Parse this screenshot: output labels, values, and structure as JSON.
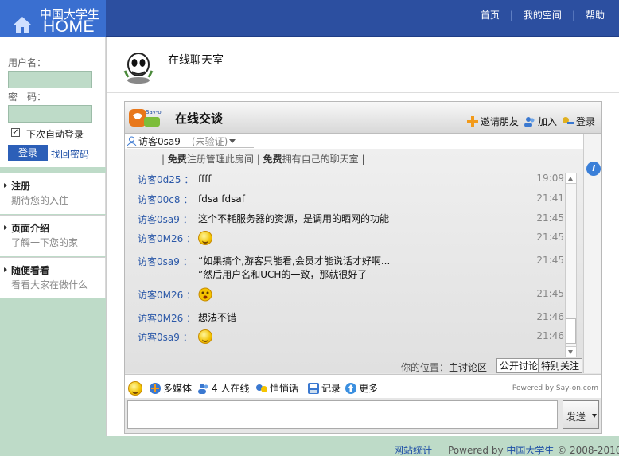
{
  "logo": {
    "cn": "中国大学生",
    "en": "HOME"
  },
  "topnav": [
    "首页",
    "我的空间",
    "帮助"
  ],
  "sidebar": {
    "username_label": "用户名：",
    "password_label": "密　码：",
    "remember_label": "下次自动登录",
    "login_label": "登录",
    "forgot_label": "找回密码",
    "sections": [
      {
        "title": "注册",
        "desc": "期待您的入住"
      },
      {
        "title": "页面介绍",
        "desc": "了解一下您的家"
      },
      {
        "title": "随便看看",
        "desc": "看看大家在做什么"
      }
    ]
  },
  "page_title": "在线聊天室",
  "chat": {
    "title": "在线交谈",
    "actions": [
      "邀请朋友",
      "加入",
      "登录"
    ],
    "user": {
      "name": "访客0sa9",
      "status": "(未验证)"
    },
    "notice": {
      "sep": "|",
      "free1": "免费",
      "text1": "注册管理此房间",
      "free2": "免费",
      "text2": "拥有自己的聊天室"
    },
    "colon": "：",
    "messages": [
      {
        "who": "访客0d25",
        "text": "ffff",
        "time": "19:09"
      },
      {
        "who": "访客00c8",
        "text": "fdsa fdsaf",
        "time": "21:41"
      },
      {
        "who": "访客0sa9",
        "text": "这个不耗服务器的资源，是调用的晒网的功能",
        "time": "21:45"
      },
      {
        "who": "访客0M26",
        "text": "",
        "time": "21:45",
        "emoji": "smile-icon"
      },
      {
        "who": "访客0sa9",
        "text": "“如果搞个,游客只能看,会员才能说话才好啊...",
        "text2": "”然后用户名和UCH的一致，那就很好了",
        "time": "21:45"
      },
      {
        "who": "访客0M26",
        "text": "",
        "time": "21:45",
        "emoji": "shocked-icon"
      },
      {
        "who": "访客0M26",
        "text": "想法不错",
        "time": "21:46"
      },
      {
        "who": "访客0sa9",
        "text": "",
        "time": "21:46",
        "emoji": "smile-icon"
      }
    ],
    "location_label": "你的位置：",
    "location_value": "主讨论区",
    "tabs": [
      "公开讨论",
      "特别关注"
    ],
    "toolbar": {
      "media": "多媒体",
      "online": "4 人在线",
      "whisper": "悄悄话",
      "log": "记录",
      "more": "更多",
      "powered": "Powered by  Say-on.com"
    },
    "send_label": "发送"
  },
  "footer": {
    "stats": "网站统计",
    "powered": "Powered by ",
    "brand": "中国大学生",
    "copy": " © 2008-2010"
  }
}
